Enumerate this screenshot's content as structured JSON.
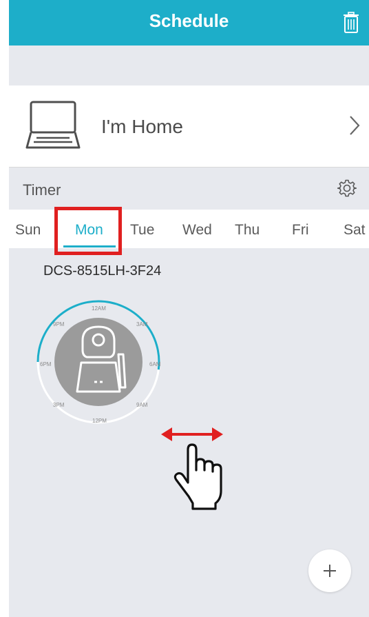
{
  "header": {
    "title": "Schedule",
    "trash_icon": "trash-icon"
  },
  "profile": {
    "label": "I'm Home",
    "icon": "laptop-icon"
  },
  "timer": {
    "label": "Timer",
    "settings_icon": "gear-icon"
  },
  "days": [
    "Sun",
    "Mon",
    "Tue",
    "Wed",
    "Thu",
    "Fri",
    "Sat"
  ],
  "selected_day": "Mon",
  "device": {
    "name": "DCS-8515LH-3F24",
    "dial_labels": [
      "12AM",
      "3AM",
      "6AM",
      "9AM",
      "12PM",
      "3PM",
      "6PM",
      "9PM"
    ]
  },
  "colors": {
    "accent": "#1daec9",
    "highlight": "#e02020",
    "background": "#e7e9ee"
  },
  "fab": {
    "icon": "plus-icon"
  }
}
